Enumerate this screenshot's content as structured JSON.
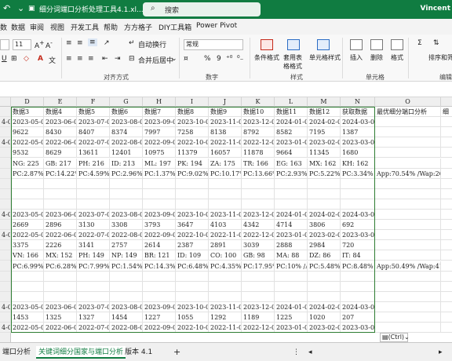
{
  "titlebar": {
    "title": "细分词端口分析处理工具4.1.xl...",
    "search_placeholder": "搜索",
    "user": "Vincent"
  },
  "menu": [
    "数",
    "数据",
    "审阅",
    "视图",
    "开发工具",
    "帮助",
    "方方格子",
    "DIY工具箱",
    "Power Pivot"
  ],
  "ribbon": {
    "font_size": "11",
    "wrap_text": "自动换行",
    "merge_center": "合并后居中",
    "number_format": "常规",
    "percent": "%",
    "comma": "9",
    "cond_format": "条件格式",
    "table_format": "套用表格格式",
    "cell_style": "单元格样式",
    "insert": "插入",
    "delete": "删除",
    "format": "格式",
    "sort_filter": "排序和筛",
    "groups": [
      "对齐方式",
      "数字",
      "样式",
      "单元格",
      "编辑"
    ]
  },
  "columns": [
    "D",
    "E",
    "F",
    "G",
    "H",
    "I",
    "J",
    "K",
    "L",
    "M",
    "N",
    "O"
  ],
  "rows": [
    [
      "",
      "数据3",
      "数据4",
      "数据5",
      "数据6",
      "数据7",
      "数据8",
      "数据9",
      "数据10",
      "数据11",
      "数据12",
      "获取数据",
      "最优细分端口分析",
      "细"
    ],
    [
      "4-01",
      "2023-05-01",
      "2023-06-01",
      "2023-07-01",
      "2023-08-01",
      "2023-09-01",
      "2023-10-01",
      "2023-11-01",
      "2023-12-01",
      "2024-01-01",
      "2024-02-01",
      "2024-03-01",
      "",
      ""
    ],
    [
      "",
      "9622",
      "8430",
      "8407",
      "8374",
      "7997",
      "7258",
      "8138",
      "8792",
      "8582",
      "7195",
      "1387",
      "",
      ""
    ],
    [
      "4-01",
      "2022-05-01",
      "2022-06-01",
      "2022-07-01",
      "2022-08-01",
      "2022-09-01",
      "2022-10-01",
      "2022-11-01",
      "2022-12-01",
      "2023-01-01",
      "2023-02-01",
      "2023-03-01",
      "",
      ""
    ],
    [
      "",
      "9532",
      "8629",
      "13611",
      "12401",
      "10975",
      "11379",
      "16057",
      "11878",
      "9664",
      "11345",
      "1680",
      "",
      ""
    ],
    [
      "",
      "NG: 225",
      "GB: 217",
      "PH: 216",
      "ID: 213",
      "ML: 197",
      "PK: 194",
      "ZA: 175",
      "TR: 166",
      "EG: 163",
      "MX: 162",
      "KH: 162",
      "",
      ""
    ],
    [
      "",
      "PC:2.87%",
      "PC:14.22%",
      "PC:4.59%",
      "PC:2.96%",
      "PC:1.37%",
      "PC:9.02%",
      "PC:10.17%",
      "PC:13.66%",
      "PC:2.93%",
      "PC:5.22%",
      "PC:3.34%",
      "App:70.54% /Wap:26.12%",
      ""
    ],
    [
      "",
      "",
      "",
      "",
      "",
      "",
      "",
      "",
      "",
      "",
      "",
      "",
      "",
      ""
    ],
    [
      "",
      "",
      "",
      "",
      "",
      "",
      "",
      "",
      "",
      "",
      "",
      "",
      "",
      ""
    ],
    [
      "",
      "",
      "",
      "",
      "",
      "",
      "",
      "",
      "",
      "",
      "",
      "",
      "",
      ""
    ],
    [
      "4-01",
      "2023-05-01",
      "2023-06-01",
      "2023-07-01",
      "2023-08-01",
      "2023-09-01",
      "2023-10-01",
      "2023-11-01",
      "2023-12-01",
      "2024-01-01",
      "2024-02-01",
      "2024-03-01",
      "",
      ""
    ],
    [
      "",
      "2669",
      "2896",
      "3130",
      "3308",
      "3793",
      "3647",
      "4103",
      "4342",
      "4714",
      "3806",
      "692",
      "",
      ""
    ],
    [
      "4-01",
      "2022-05-01",
      "2022-06-01",
      "2022-07-01",
      "2022-08-01",
      "2022-09-01",
      "2022-10-01",
      "2022-11-01",
      "2022-12-01",
      "2023-01-01",
      "2023-02-01",
      "2023-03-01",
      "",
      ""
    ],
    [
      "",
      "3375",
      "2226",
      "3141",
      "2757",
      "2614",
      "2387",
      "2891",
      "3039",
      "2888",
      "2984",
      "720",
      "",
      ""
    ],
    [
      "",
      "VN: 166",
      "MX: 152",
      "PH: 149",
      "NP: 149",
      "BR: 121",
      "ID: 109",
      "CO: 100",
      "GB: 98",
      "MA: 88",
      "DZ: 86",
      "IT: 84",
      "",
      ""
    ],
    [
      "",
      "PC:6.99%",
      "PC:6.28%",
      "PC:7.99%",
      "PC:1.54%",
      "PC:14.3%",
      "PC:6.48%",
      "PC:4.35%",
      "PC:17.95%",
      "PC:10% /Ap",
      "PC:5.48%",
      "PC:8.48%",
      "App:50.49% /Wap:41.03%",
      ""
    ],
    [
      "",
      "",
      "",
      "",
      "",
      "",
      "",
      "",
      "",
      "",
      "",
      "",
      "",
      ""
    ],
    [
      "",
      "",
      "",
      "",
      "",
      "",
      "",
      "",
      "",
      "",
      "",
      "",
      "",
      ""
    ],
    [
      "",
      "",
      "",
      "",
      "",
      "",
      "",
      "",
      "",
      "",
      "",
      "",
      "",
      ""
    ],
    [
      "4-01",
      "2023-05-01",
      "2023-06-01",
      "2023-07-01",
      "2023-08-01",
      "2023-09-01",
      "2023-10-01",
      "2023-11-01",
      "2023-12-01",
      "2024-01-01",
      "2024-02-01",
      "2024-03-01",
      "",
      ""
    ],
    [
      "",
      "1453",
      "1325",
      "1327",
      "1454",
      "1227",
      "1055",
      "1292",
      "1189",
      "1225",
      "1020",
      "207",
      "",
      ""
    ],
    [
      "4-01",
      "2022-05-01",
      "2022-06-01",
      "2022-07-01",
      "2022-08-01",
      "2022-09-01",
      "2022-10-01",
      "2022-11-01",
      "2022-12-01",
      "2023-01-01",
      "2023-02-01",
      "2023-03-01",
      "",
      ""
    ]
  ],
  "paste_options": "(Ctrl)",
  "sheet_tabs": [
    "端口分析",
    "关键词细分国家与端口分析",
    "版本 4.1"
  ],
  "add_sheet": "+",
  "accent": "#107c41"
}
